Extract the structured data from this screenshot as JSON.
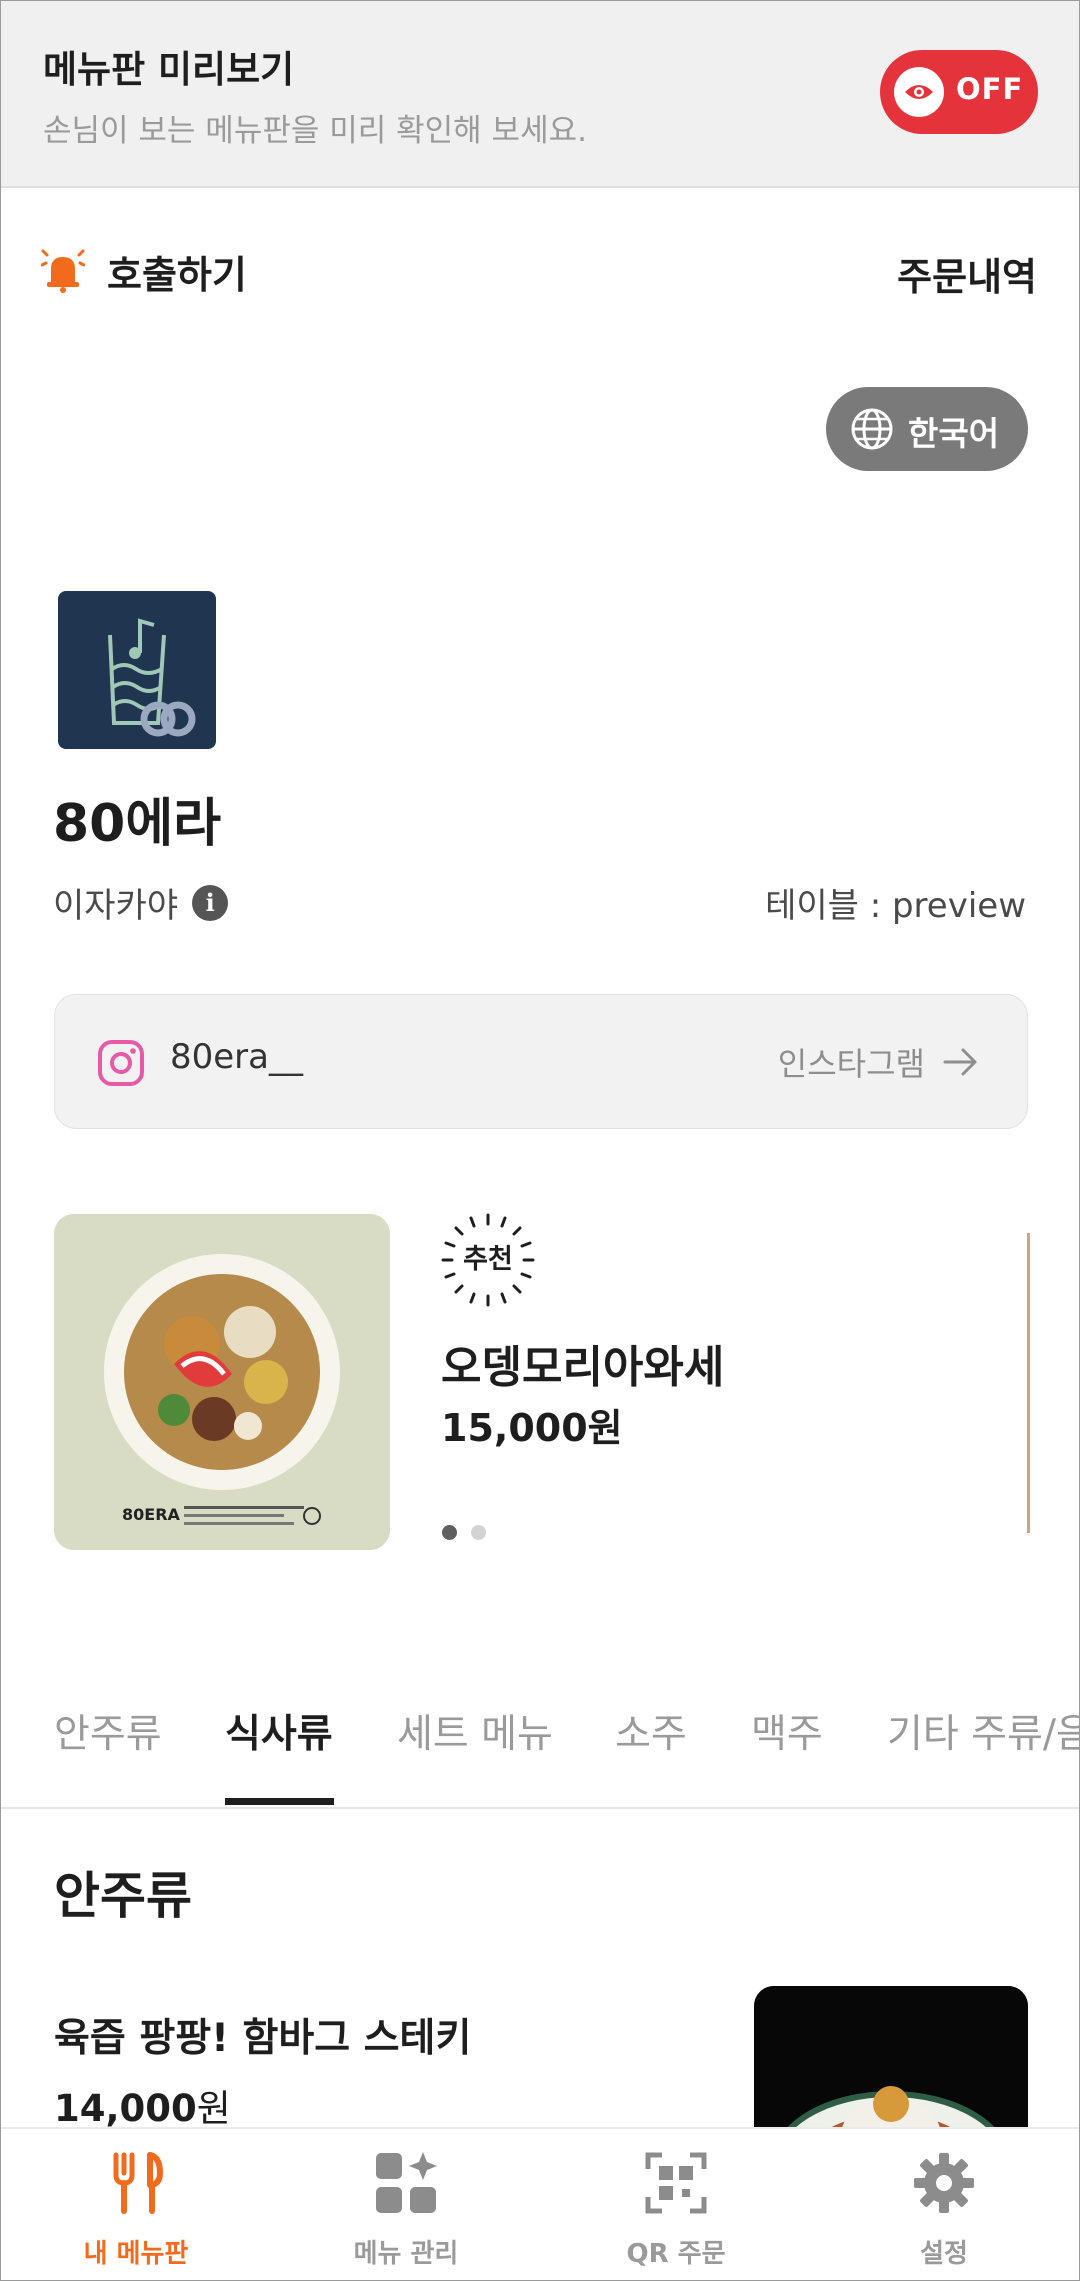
{
  "preview_banner": {
    "title": "메뉴판 미리보기",
    "subtitle": "손님이 보는 메뉴판을 미리 확인해 보세요.",
    "toggle_label": "OFF",
    "toggle_color": "#e4333a"
  },
  "top_bar": {
    "call_label": "호출하기",
    "call_icon": "bell-icon",
    "orders_label": "주문내역"
  },
  "language": {
    "label": "한국어",
    "icon": "globe-icon"
  },
  "store": {
    "name": "80에라",
    "category": "이자카야",
    "table_label": "테이블 : preview",
    "logo_color": "#1f3550"
  },
  "instagram": {
    "handle": "80era__",
    "link_label": "인스타그램"
  },
  "featured": {
    "badge": "추천",
    "name": "오뎅모리아와세",
    "price": "15,000원",
    "slide_count": 2,
    "active_slide": 1
  },
  "categories": {
    "tabs": [
      "안주류",
      "식사류",
      "세트 메뉴",
      "소주",
      "맥주",
      "기타 주류/음"
    ],
    "active_index": 1
  },
  "menu_section": {
    "title": "안주류",
    "items": [
      {
        "name": "육즙 팡팡! 함바그 스테키",
        "price": "14,000",
        "unit": "원"
      }
    ]
  },
  "bottom_nav": {
    "items": [
      {
        "label": "내 메뉴판",
        "icon": "fork-knife-icon"
      },
      {
        "label": "메뉴 관리",
        "icon": "grid-sparkle-icon"
      },
      {
        "label": "QR 주문",
        "icon": "qr-scan-icon"
      },
      {
        "label": "설정",
        "icon": "gear-icon"
      }
    ],
    "active_index": 0,
    "accent_color": "#f26a1b"
  }
}
